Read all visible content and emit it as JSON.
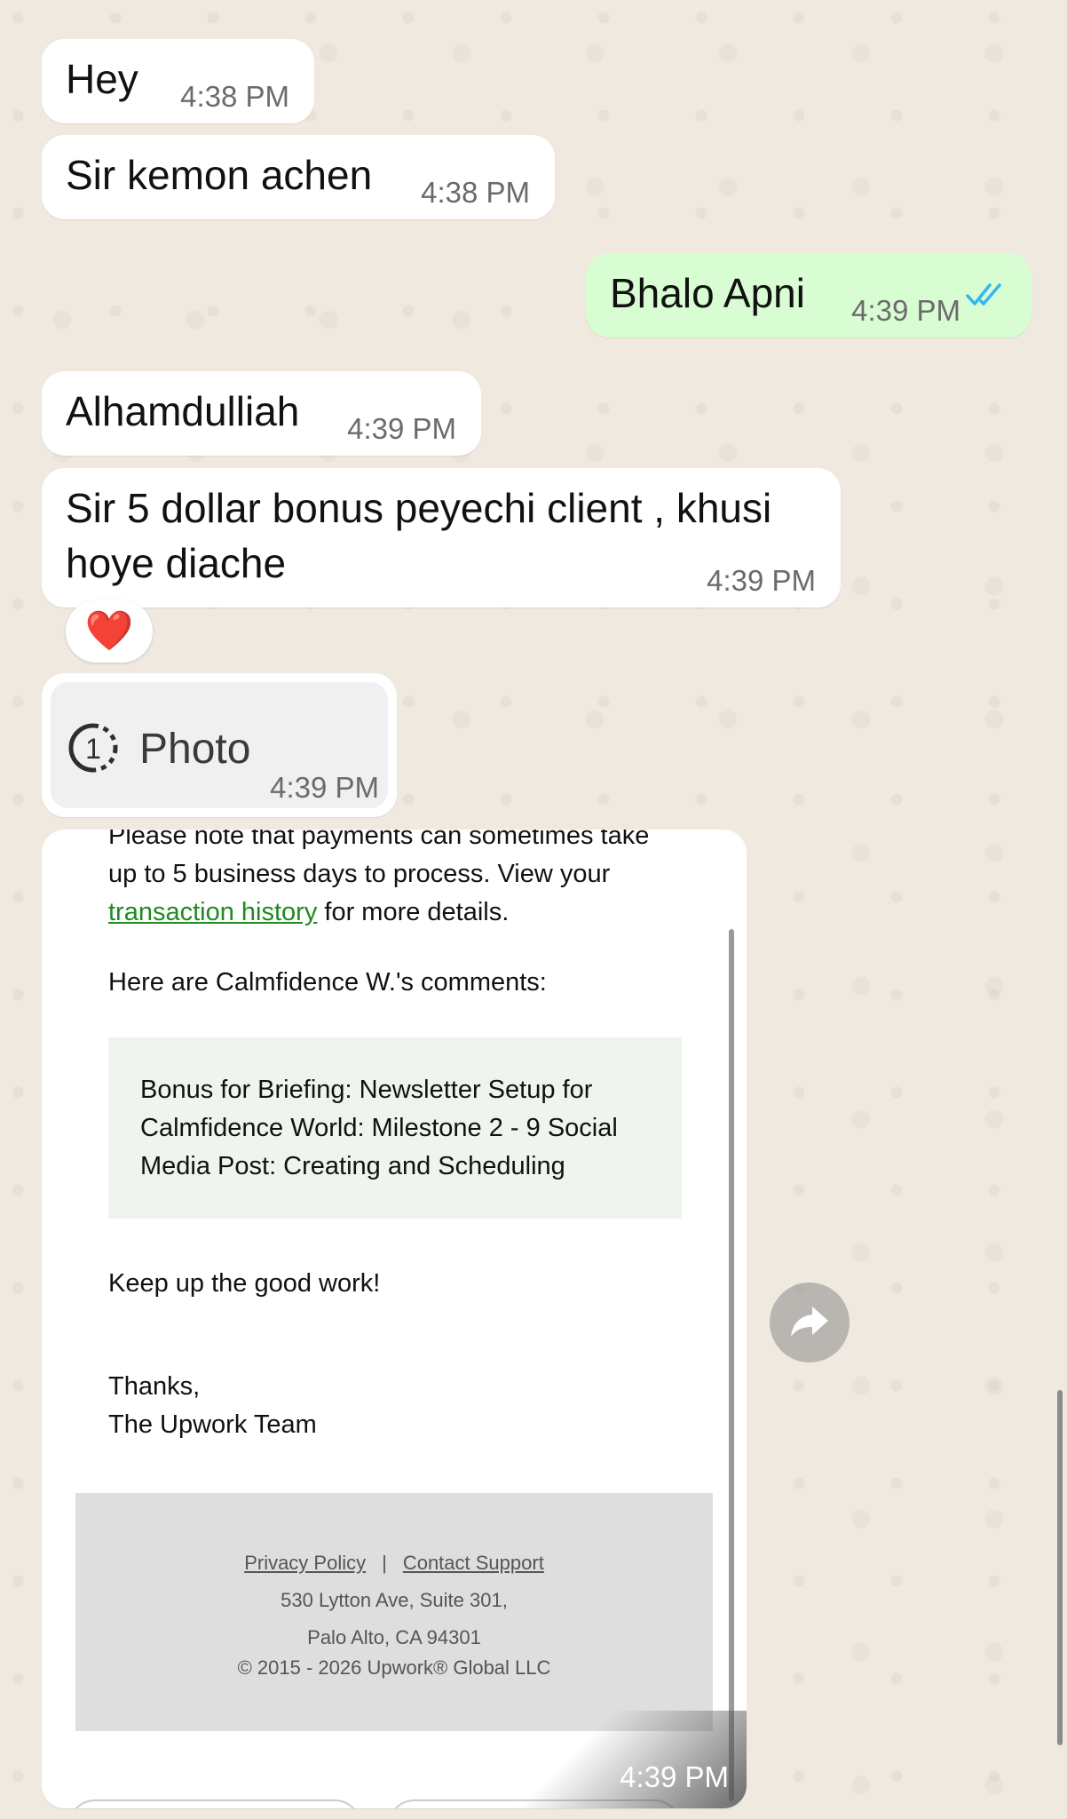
{
  "messages": [
    {
      "text": "Hey",
      "time": "4:38 PM"
    },
    {
      "text": "Sir kemon achen",
      "time": "4:38 PM"
    },
    {
      "text": "Bhalo Apni",
      "time": "4:39 PM",
      "status": "read"
    },
    {
      "text": "Alhamdulliah",
      "time": "4:39 PM"
    },
    {
      "text_line1": "Sir 5 dollar bonus peyechi client , khusi",
      "text_line2": "hoye diache",
      "time": "4:39 PM",
      "reaction": "❤️"
    },
    {
      "label": "Photo",
      "time": "4:39 PM",
      "icon": "view-once-icon"
    }
  ],
  "screenshot": {
    "cut_line": "Please note that payments can sometimes take",
    "line2": "up to 5 business days to process. View your",
    "link": "transaction history",
    "link_after": " for more details.",
    "comments_heading": "Here are Calmfidence W.'s comments:",
    "comment": "Bonus for Briefing: Newsletter Setup for Calmfidence World: Milestone 2 - 9 Social Media Post: Creating and Scheduling",
    "keep_up": "Keep up the good work!",
    "thanks": "Thanks,",
    "team": "The Upwork Team",
    "footer": {
      "privacy": "Privacy Policy",
      "separator": "|",
      "support": "Contact Support",
      "address1": "530 Lytton Ave, Suite 301,",
      "address2": "Palo Alto, CA 94301",
      "copyright": "© 2015 - 2026 Upwork® Global LLC"
    },
    "time": "4:39 PM"
  },
  "colors": {
    "wallpaper": "#efe9df",
    "incoming": "#ffffff",
    "outgoing": "#d9fdd3",
    "read_ticks": "#34b7f1",
    "link": "#1f8a1f"
  }
}
